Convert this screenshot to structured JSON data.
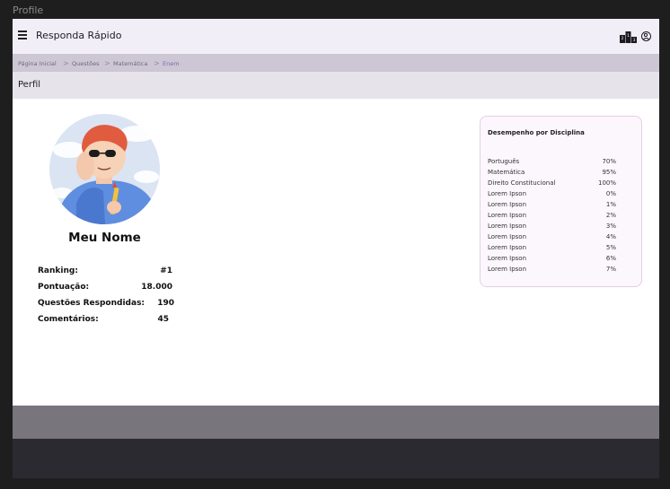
{
  "window": {
    "label": "Profile"
  },
  "appbar": {
    "title": "Responda Rápido",
    "icons": {
      "menu": "menu-icon",
      "ranking": "podium-icon",
      "account": "account-circle-icon"
    }
  },
  "breadcrumb": {
    "items": [
      {
        "label": "Página Inicial"
      },
      {
        "label": "Questões"
      },
      {
        "label": "Matemática"
      },
      {
        "label": "Enem"
      }
    ],
    "separator": ">"
  },
  "page": {
    "title": "Perfil"
  },
  "profile": {
    "name": "Meu Nome",
    "stats": [
      {
        "label": "Ranking:",
        "value": "#1"
      },
      {
        "label": "Pontuação:",
        "value": "18.000"
      },
      {
        "label": "Questões Respondidas:",
        "value": "190"
      },
      {
        "label": "Comentários:",
        "value": "45"
      }
    ]
  },
  "performance": {
    "title": "Desempenho por Disciplina",
    "rows": [
      {
        "subject": "Português",
        "percent": "70%"
      },
      {
        "subject": "Matemática",
        "percent": "95%"
      },
      {
        "subject": "Direito Constitucional",
        "percent": "100%"
      },
      {
        "subject": "Lorem Ipson",
        "percent": "0%"
      },
      {
        "subject": "Lorem Ipson",
        "percent": "1%"
      },
      {
        "subject": "Lorem Ipson",
        "percent": "2%"
      },
      {
        "subject": "Lorem Ipson",
        "percent": "3%"
      },
      {
        "subject": "Lorem Ipson",
        "percent": "4%"
      },
      {
        "subject": "Lorem Ipson",
        "percent": "5%"
      },
      {
        "subject": "Lorem Ipson",
        "percent": "6%"
      },
      {
        "subject": "Lorem Ipson",
        "percent": "7%"
      }
    ]
  },
  "colors": {
    "appbar": "#f2eef8",
    "breadcrumb_bar": "#ccc6d5",
    "title_bar": "#e7e3ea",
    "card_bg": "#fcf7fd",
    "card_border": "#e4cfe4",
    "footer_grey": "#79757d",
    "footer_dark": "#2b2a30"
  }
}
